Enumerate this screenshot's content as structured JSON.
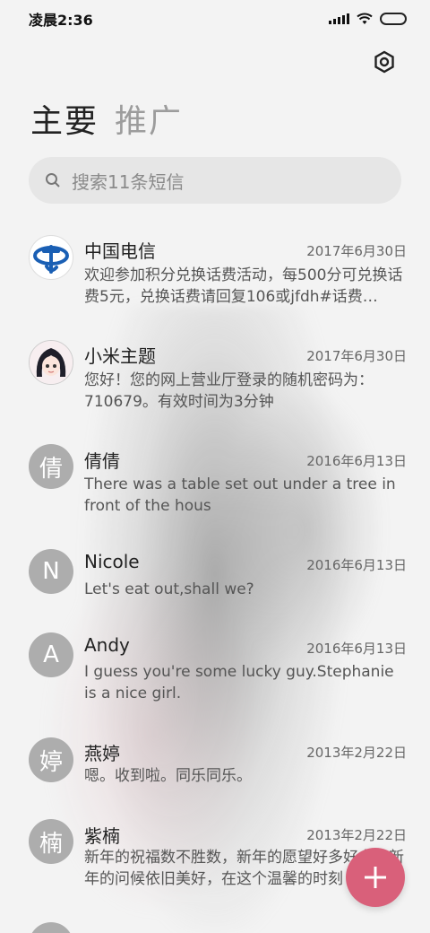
{
  "status_bar": {
    "time": "凌晨2:36"
  },
  "tabs": [
    {
      "label": "主要"
    },
    {
      "label": "推广"
    }
  ],
  "search": {
    "placeholder": "搜索11条短信"
  },
  "messages": [
    {
      "name": "中国电信",
      "date": "2017年6月30日",
      "preview": "欢迎参加积分兑换话费活动，每500分可兑换话费5元，兑换话费请回复106或jfdh#话费…",
      "avatar": "china-telecom-logo"
    },
    {
      "name": "小米主题",
      "date": "2017年6月30日",
      "preview": "您好！您的网上营业厅登录的随机密码为：710679。有效时间为3分钟",
      "avatar": "anime-girl-avatar"
    },
    {
      "name": "倩倩",
      "date": "2016年6月13日",
      "preview": "There was a table set out under a tree in front of the hous",
      "avatar_letter": "倩"
    },
    {
      "name": "Nicole",
      "date": "2016年6月13日",
      "preview": "Let's eat out,shall we?",
      "avatar_letter": "N"
    },
    {
      "name": "Andy",
      "date": "2016年6月13日",
      "preview": "I guess you're some lucky guy.Stephanie is a nice girl.",
      "avatar_letter": "A"
    },
    {
      "name": "燕婷",
      "date": "2013年2月22日",
      "preview": "嗯。收到啦。同乐同乐。",
      "avatar_letter": "婷"
    },
    {
      "name": "紫楠",
      "date": "2013年2月22日",
      "preview": "新年的祝福数不胜数，新年的愿望好多好多，新年的问候依旧美好，在这个温馨的时刻",
      "avatar_letter": "楠"
    }
  ],
  "colors": {
    "fab": "#d9607a",
    "avatar_bg": "#adadad",
    "telecom_blue": "#1a5fb4"
  }
}
